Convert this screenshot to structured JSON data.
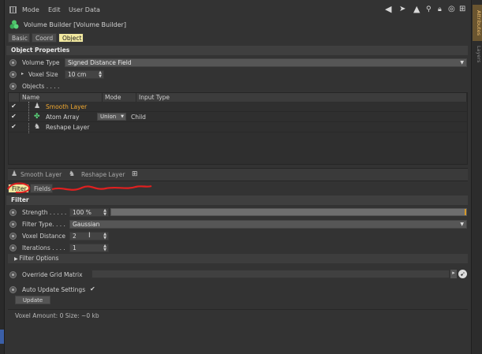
{
  "menubar": {
    "items": [
      "Mode",
      "Edit",
      "User Data"
    ],
    "icons": [
      "back-arrow-icon",
      "cursor-arrow-icon",
      "up-arrow-icon",
      "search-icon",
      "lock-icon",
      "target-icon",
      "new-window-icon"
    ]
  },
  "header": {
    "title": "Volume Builder [Volume Builder]"
  },
  "tabs": [
    {
      "label": "Basic",
      "active": false
    },
    {
      "label": "Coord",
      "active": false
    },
    {
      "label": "Object",
      "active": true
    }
  ],
  "object_properties": {
    "heading": "Object Properties",
    "volume_type_label": "Volume Type",
    "volume_type_value": "Signed Distance Field",
    "voxel_size_label": "Voxel Size",
    "voxel_size_value": "10 cm",
    "objects_label": "Objects . . . ."
  },
  "object_table": {
    "columns": [
      "Name",
      "Mode",
      "Input Type"
    ],
    "rows": [
      {
        "name": "Smooth Layer",
        "mode": "",
        "input_type": "",
        "highlight": true
      },
      {
        "name": "Atom Array",
        "mode": "Union",
        "input_type": "Child",
        "highlight": false
      },
      {
        "name": "Reshape Layer",
        "mode": "",
        "input_type": "",
        "highlight": false
      }
    ]
  },
  "layer_bar": {
    "items": [
      "Smooth Layer",
      "Reshape Layer"
    ]
  },
  "sub_tabs": [
    {
      "label": "Filter",
      "active": true
    },
    {
      "label": "Fields",
      "active": false
    }
  ],
  "filter": {
    "heading": "Filter",
    "strength_label": "Strength . . . . .",
    "strength_value": "100 %",
    "strength_level": 1.0,
    "filter_type_label": "Filter Type. . . .",
    "filter_type_value": "Gaussian",
    "voxel_distance_label": "Voxel Distance",
    "voxel_distance_value": "2",
    "iterations_label": "Iterations . . . .",
    "iterations_value": "1",
    "filter_options_label": "Filter Options"
  },
  "grid": {
    "override_label": "Override Grid Matrix"
  },
  "auto_update": {
    "label": "Auto Update Settings",
    "checked": true,
    "update_button": "Update"
  },
  "status": {
    "text": "Voxel Amount: 0   Size: ~0 kb"
  },
  "side_tabs": [
    "Attributes",
    "Layers"
  ],
  "colors": {
    "accent_orange": "#f0a830",
    "tab_active_bg": "#f2e9a0",
    "annotation_red": "#e02020"
  }
}
